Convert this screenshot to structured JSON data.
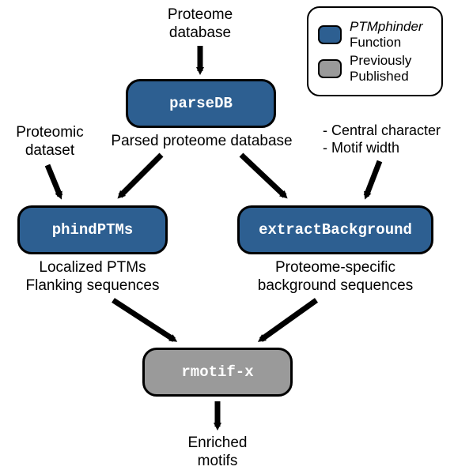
{
  "inputs": {
    "proteome_db": "Proteome\ndatabase",
    "proteomic_dataset": "Proteomic\ndataset",
    "motif_params_1": "- Central character",
    "motif_params_2": "- Motif width"
  },
  "nodes": {
    "parseDB": "parseDB",
    "phindPTMs": "phindPTMs",
    "extractBackground": "extractBackground",
    "rmotifx": "rmotif-x"
  },
  "outputs": {
    "parsed_db": "Parsed proteome database",
    "localized_1": "Localized PTMs",
    "localized_2": "Flanking sequences",
    "background_1": "Proteome-specific",
    "background_2": "background sequences",
    "enriched": "Enriched\nmotifs"
  },
  "legend": {
    "blue_1": "PTMphinder",
    "blue_2": "Function",
    "gray_1": "Previously",
    "gray_2": "Published"
  },
  "colors": {
    "blue": "#2d5f91",
    "gray": "#9a9a9a"
  }
}
